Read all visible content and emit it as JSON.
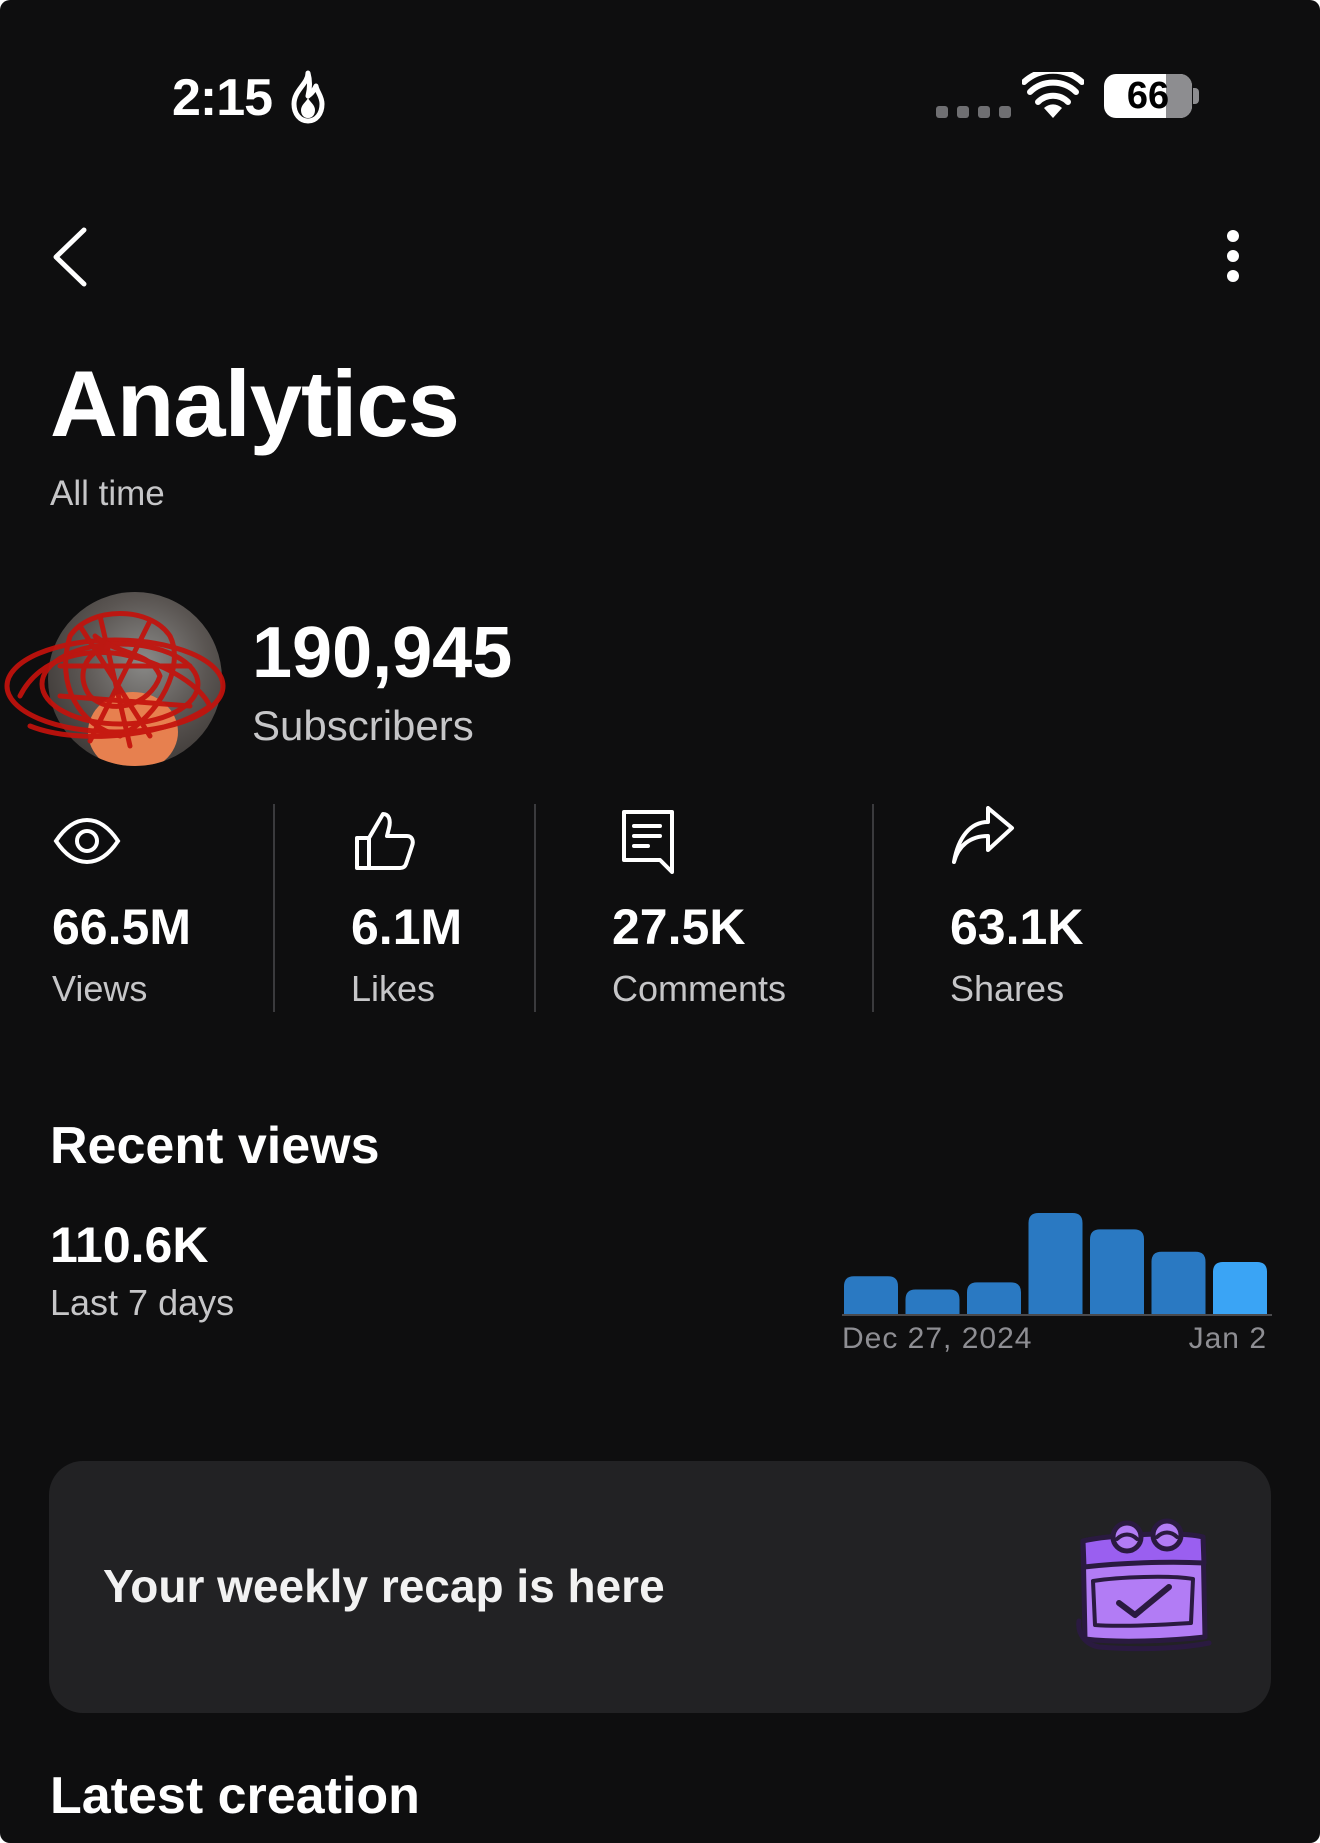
{
  "status_bar": {
    "time": "2:15",
    "battery_level": "66"
  },
  "header": {
    "title": "Analytics",
    "subtitle": "All time"
  },
  "profile": {
    "subscribers_count": "190,945",
    "subscribers_label": "Subscribers"
  },
  "stats": [
    {
      "value": "66.5M",
      "label": "Views",
      "icon": "eye-icon"
    },
    {
      "value": "6.1M",
      "label": "Likes",
      "icon": "thumbs-up-icon"
    },
    {
      "value": "27.5K",
      "label": "Comments",
      "icon": "comment-icon"
    },
    {
      "value": "63.1K",
      "label": "Shares",
      "icon": "share-icon"
    }
  ],
  "recent_views": {
    "title": "Recent views",
    "value": "110.6K",
    "label": "Last 7 days",
    "start_date": "Dec 27, 2024",
    "end_date": "Jan 2"
  },
  "chart_data": {
    "type": "bar",
    "values": [
      38,
      25,
      32,
      100,
      84,
      62,
      52
    ],
    "colors": [
      "#2a79c2",
      "#2a79c2",
      "#2a79c2",
      "#2a79c2",
      "#2a79c2",
      "#2a79c2",
      "#3aa4f5"
    ]
  },
  "recap": {
    "text": "Your weekly recap is here",
    "icon": "calendar-check-icon",
    "icon_color": "#b27cf5"
  },
  "latest": {
    "title": "Latest creation"
  }
}
